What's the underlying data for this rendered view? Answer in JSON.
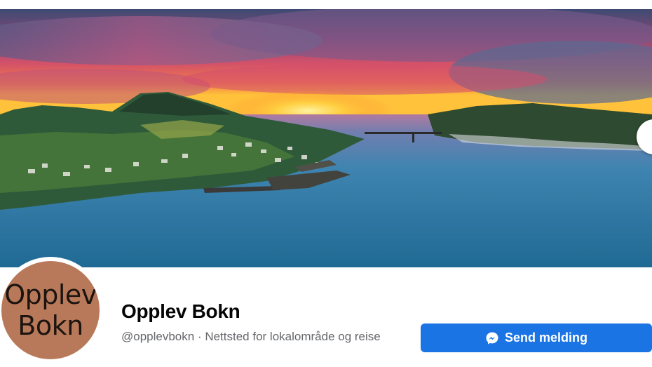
{
  "profile": {
    "name": "Opplev Bokn",
    "handle": "@opplevbokn",
    "separator": " · ",
    "category": "Nettsted for lokalområde og reise",
    "avatar_line1": "Opplev",
    "avatar_line2": "Bokn"
  },
  "actions": {
    "send_message_label": "Send melding"
  },
  "icons": {
    "send": "messenger-icon"
  },
  "colors": {
    "primary_button": "#1b74e4",
    "avatar_bg": "#b8795a",
    "subtitle_text": "#65676b"
  }
}
